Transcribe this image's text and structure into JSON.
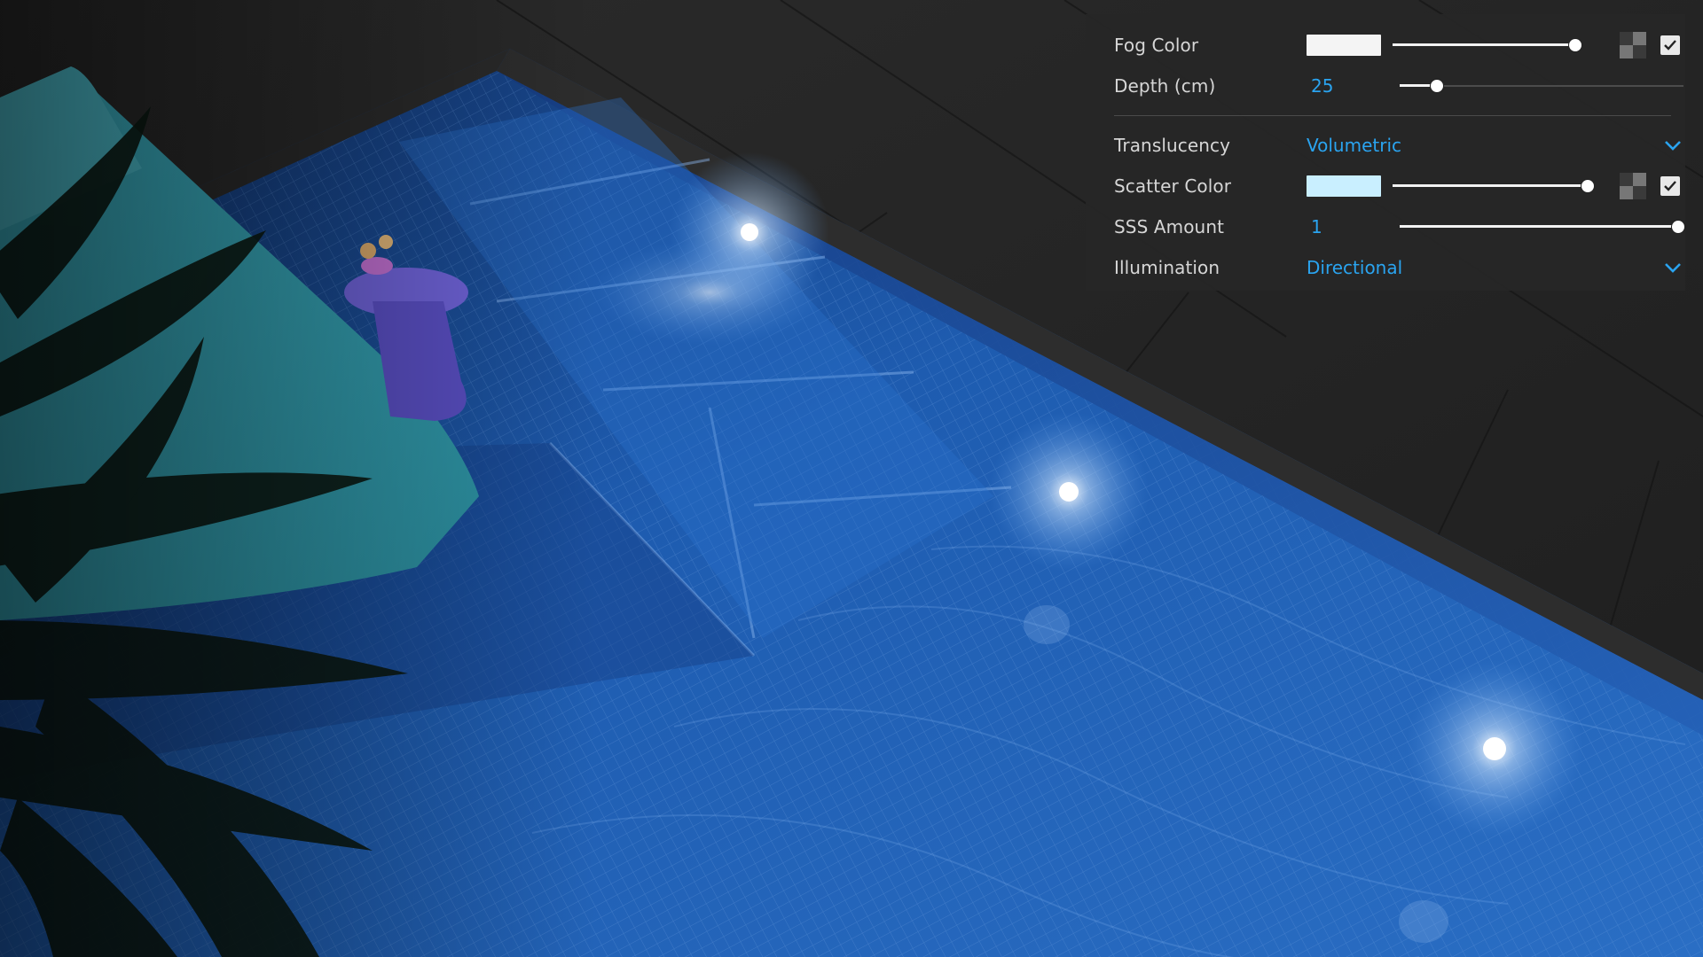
{
  "panel": {
    "fog_color": {
      "label": "Fog Color",
      "swatch": "#f4f4f4",
      "slider_value": 0.97,
      "checked": true
    },
    "depth": {
      "label": "Depth (cm)",
      "value": "25",
      "slider_value": 0.13
    },
    "translucency": {
      "label": "Translucency",
      "value": "Volumetric"
    },
    "scatter_color": {
      "label": "Scatter Color",
      "swatch": "#c9efff",
      "slider_value": 1.0,
      "checked": true
    },
    "sss_amount": {
      "label": "SSS Amount",
      "value": "1",
      "slider_value": 1.0
    },
    "illumination": {
      "label": "Illumination",
      "value": "Directional"
    }
  },
  "colors": {
    "accent": "#2aa4f0",
    "panel_bg": "#262626",
    "pool_blue": "#1f5fb5"
  }
}
